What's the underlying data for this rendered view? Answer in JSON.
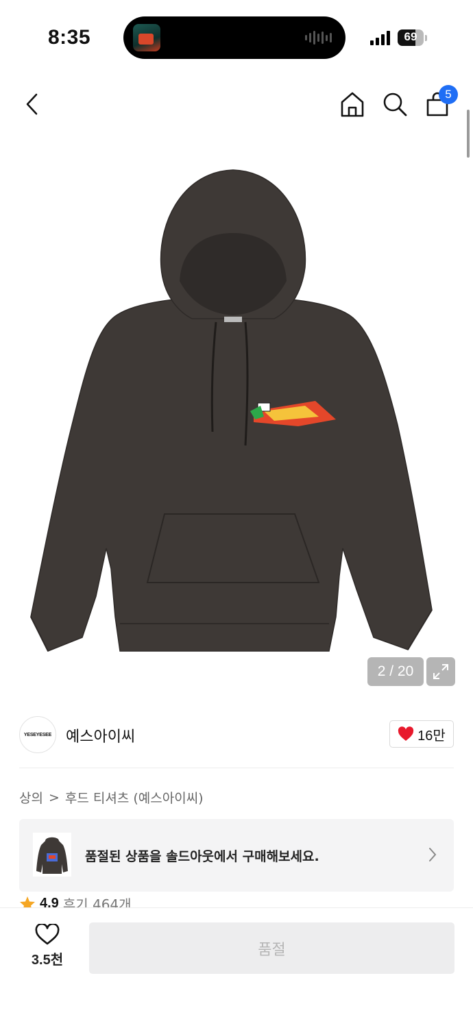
{
  "status_bar": {
    "time": "8:35",
    "battery": "69",
    "battery_level_percent": 69
  },
  "nav": {
    "back_icon": "chevron-left-icon",
    "home_icon": "home-icon",
    "search_icon": "search-icon",
    "cart_icon": "shopping-bag-icon",
    "cart_count": "5"
  },
  "gallery": {
    "counter": "2 / 20",
    "expand_icon": "expand-icon"
  },
  "brand": {
    "logo_text": "YESEYESEE",
    "name": "예스아이씨",
    "likes": "16만"
  },
  "breadcrumb": {
    "category": "상의",
    "separator": ">",
    "subcategory": "후드 티셔츠 (예스아이씨)"
  },
  "soldout_banner": {
    "text": "품절된 상품을 솔드아웃에서 구매해보세요."
  },
  "rating": {
    "score": "4.9",
    "reviews": "후기 464개"
  },
  "bottom": {
    "wish_count": "3.5천",
    "buy_label": "품절"
  },
  "colors": {
    "accent": "#1f6ef5",
    "heart": "#e8192c",
    "star": "#f5a623",
    "hoodie": "#3e3936"
  }
}
